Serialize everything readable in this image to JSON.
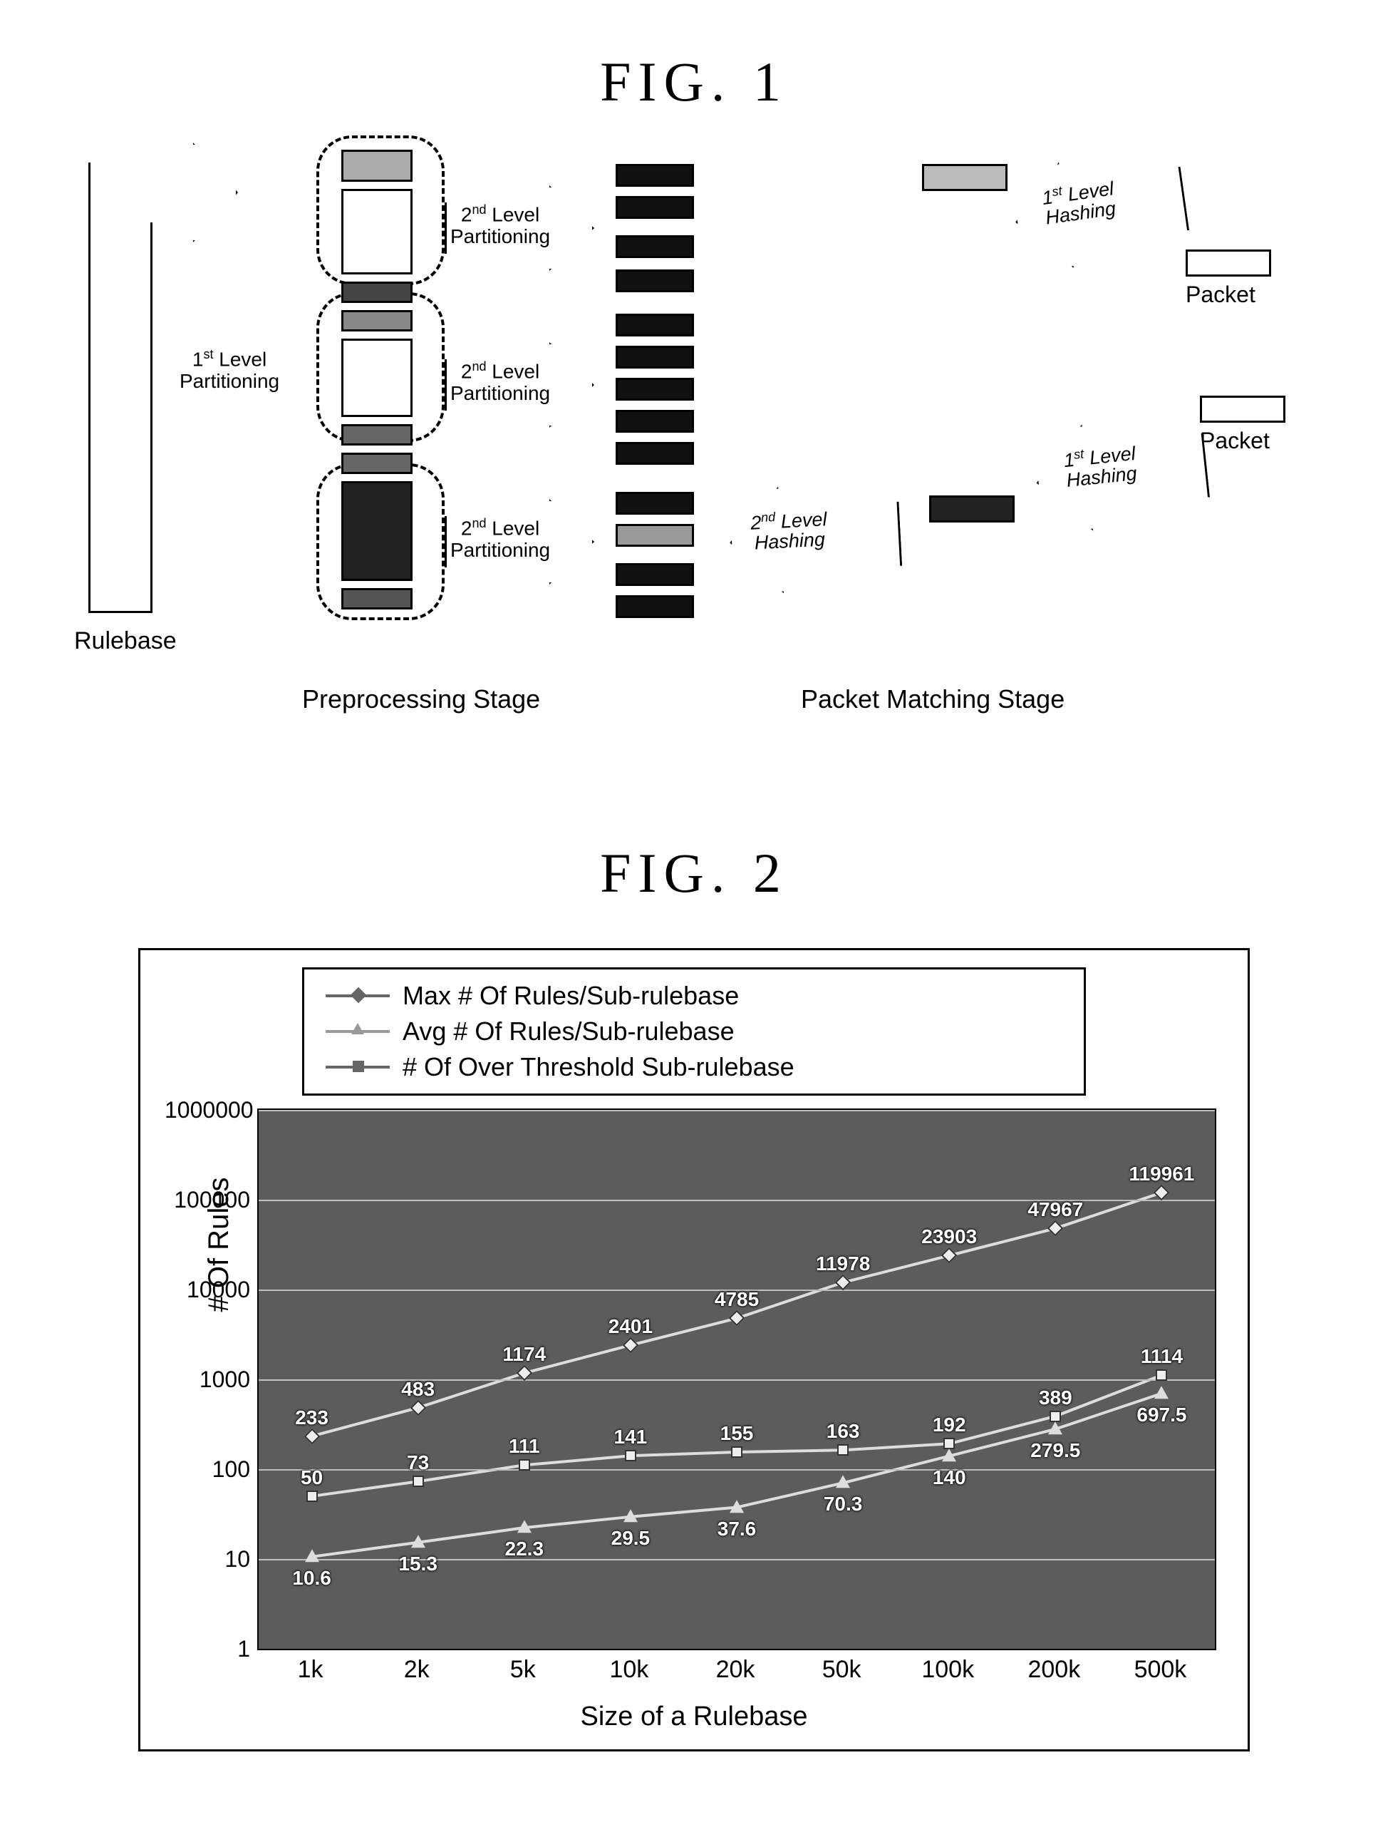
{
  "fig1": {
    "title": "FIG. 1",
    "rulebase_label": "Rulebase",
    "arrow_1st_level_partitioning": "1st Level\nPartitioning",
    "arrow_2nd_level_partitioning": "2nd Level\nPartitioning",
    "arrow_1st_level_hashing": "1st Level\nHashing",
    "arrow_2nd_level_hashing": "2nd Level\nHashing",
    "packet_label": "Packet",
    "preprocessing_stage": "Preprocessing Stage",
    "packet_matching_stage": "Packet Matching Stage"
  },
  "fig2": {
    "title": "FIG. 2",
    "ylabel": "# Of Rules",
    "xlabel": "Size of a Rulebase",
    "legend": {
      "max": "Max # Of Rules/Sub-rulebase",
      "avg": "Avg # Of Rules/Sub-rulebase",
      "over": "# Of Over Threshold Sub-rulebase"
    }
  },
  "chart_data": {
    "type": "line",
    "xlabel": "Size of a Rulebase",
    "ylabel": "# Of Rules",
    "yscale": "log",
    "ylim": [
      1,
      1000000
    ],
    "yticks": [
      1,
      10,
      100,
      1000,
      10000,
      100000,
      1000000
    ],
    "categories": [
      "1k",
      "2k",
      "5k",
      "10k",
      "20k",
      "50k",
      "100k",
      "200k",
      "500k"
    ],
    "series": [
      {
        "name": "Max # Of Rules/Sub-rulebase",
        "marker": "diamond",
        "values": [
          233,
          483,
          1174,
          2401,
          4785,
          11978,
          23903,
          47967,
          119961
        ]
      },
      {
        "name": "# Of Over Threshold Sub-rulebase",
        "marker": "square",
        "values": [
          50,
          73,
          111,
          141,
          155,
          163,
          192,
          389,
          1114
        ]
      },
      {
        "name": "Avg # Of Rules/Sub-rulebase",
        "marker": "triangle",
        "values": [
          10.6,
          15.3,
          22.3,
          29.5,
          37.6,
          70.3,
          140.0,
          279.5,
          697.5
        ]
      }
    ],
    "legend_position": "top"
  }
}
